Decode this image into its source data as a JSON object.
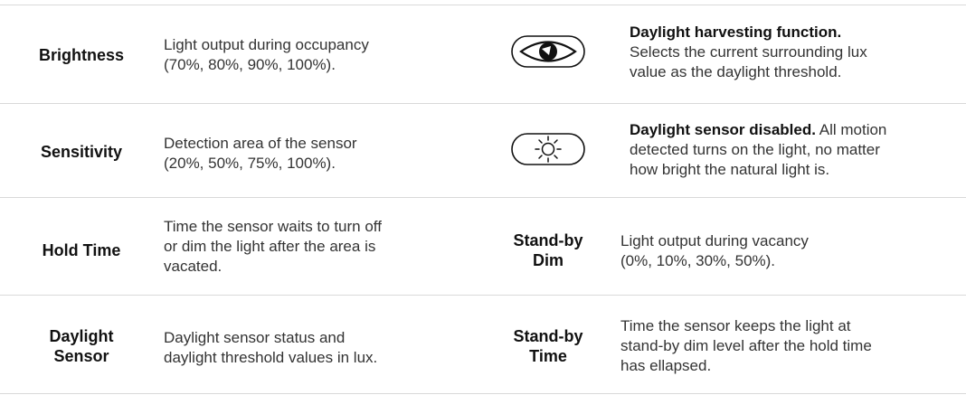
{
  "rows": [
    {
      "left": {
        "term": "Brightness",
        "desc": [
          "Light output during occupancy",
          "(70%, 80%, 90%, 100%)."
        ]
      },
      "right": {
        "icon": "daylight-harvesting-eye-icon",
        "bold": "Daylight harvesting function.",
        "desc": [
          "Selects the current surrounding lux",
          "value as the daylight threshold."
        ]
      }
    },
    {
      "left": {
        "term": "Sensitivity",
        "desc": [
          "Detection area of the sensor",
          "(20%, 50%, 75%, 100%)."
        ]
      },
      "right": {
        "icon": "daylight-sensor-disabled-sun-icon",
        "bold": "Daylight sensor disabled.",
        "bold_tail": " All motion",
        "desc": [
          "detected turns on the light, no matter",
          "how bright the natural light is."
        ]
      }
    },
    {
      "left": {
        "term": "Hold Time",
        "desc": [
          "Time the sensor waits to turn off",
          "or dim the light after the area is",
          "vacated."
        ]
      },
      "right": {
        "term": [
          "Stand-by",
          "Dim"
        ],
        "desc": [
          "Light output during vacancy",
          "(0%, 10%, 30%, 50%)."
        ]
      }
    },
    {
      "left": {
        "term": [
          "Daylight",
          "Sensor"
        ],
        "desc": [
          "Daylight sensor status and",
          "daylight threshold values in lux."
        ]
      },
      "right": {
        "term": [
          "Stand-by",
          "Time"
        ],
        "desc": [
          "Time the sensor keeps the light at",
          "stand-by dim level after the hold time",
          "has ellapsed."
        ]
      }
    }
  ],
  "colors": {
    "rule": "#d9d9d9",
    "text": "#333333",
    "term": "#111111"
  }
}
